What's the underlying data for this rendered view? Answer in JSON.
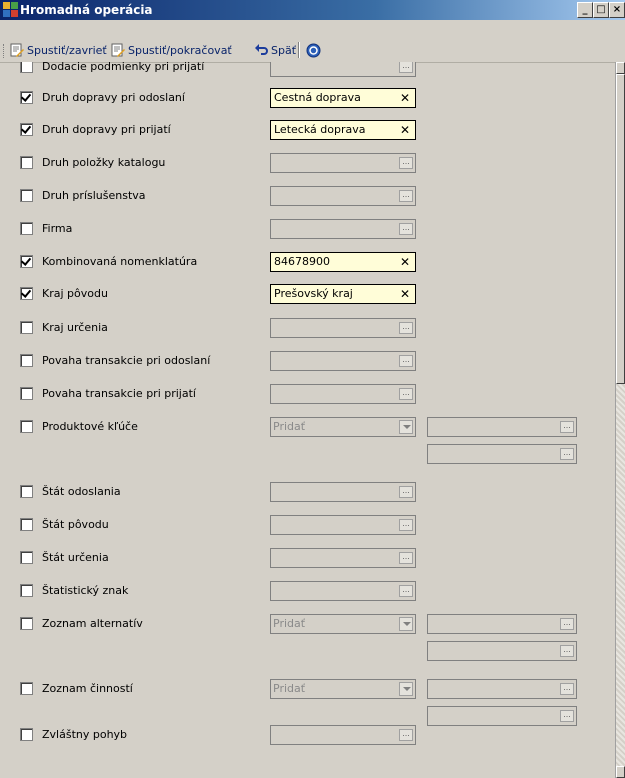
{
  "window": {
    "title": "Hromadná operácia"
  },
  "toolbar": {
    "run_close_label": "Spustiť/zavrieť",
    "run_continue_label": "Spustiť/pokračovať",
    "back_label": "Späť"
  },
  "rows": [
    {
      "label": "Dodacie podmienky pri prijatí",
      "checked": false,
      "kind": "field"
    },
    {
      "label": "Druh dopravy pri odoslaní",
      "checked": true,
      "kind": "field",
      "value": "Cestná doprava"
    },
    {
      "label": "Druh dopravy pri prijatí",
      "checked": true,
      "kind": "field",
      "value": "Letecká doprava"
    },
    {
      "label": "Druh položky katalogu",
      "checked": false,
      "kind": "field"
    },
    {
      "label": "Druh príslušenstva",
      "checked": false,
      "kind": "field"
    },
    {
      "label": "Firma",
      "checked": false,
      "kind": "field"
    },
    {
      "label": "Kombinovaná nomenklatúra",
      "checked": true,
      "kind": "field",
      "value": "84678900"
    },
    {
      "label": "Kraj pôvodu",
      "checked": true,
      "kind": "field",
      "value": "Prešovský kraj"
    },
    {
      "label": "Kraj určenia",
      "checked": false,
      "kind": "field"
    },
    {
      "label": "Povaha transakcie pri odoslaní",
      "checked": false,
      "kind": "field"
    },
    {
      "label": "Povaha transakcie pri prijatí",
      "checked": false,
      "kind": "field"
    },
    {
      "label": "Produktové kľúče",
      "checked": false,
      "kind": "combo",
      "value": "Pridať"
    },
    {
      "label": "Štát odoslania",
      "checked": false,
      "kind": "field"
    },
    {
      "label": "Štát pôvodu",
      "checked": false,
      "kind": "field"
    },
    {
      "label": "Štát určenia",
      "checked": false,
      "kind": "field"
    },
    {
      "label": "Štatistický znak",
      "checked": false,
      "kind": "field"
    },
    {
      "label": "Zoznam alternatív",
      "checked": false,
      "kind": "combo",
      "value": "Pridať"
    },
    {
      "label": "Zoznam činností",
      "checked": false,
      "kind": "combo",
      "value": "Pridať"
    },
    {
      "label": "Zvláštny pohyb",
      "checked": false,
      "kind": "field"
    }
  ]
}
